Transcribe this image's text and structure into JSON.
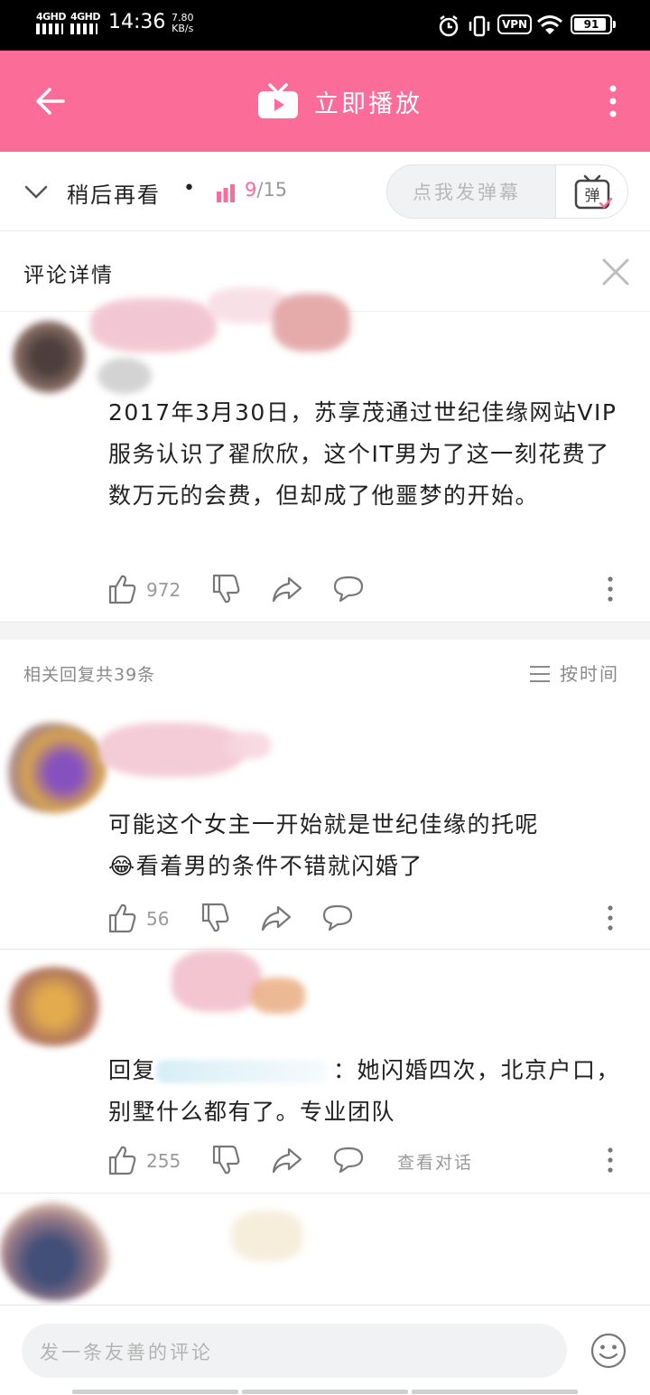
{
  "status_bar": {
    "network1": "4GHD",
    "network2": "4GHD",
    "time": "14:36",
    "speed_value": "7.80",
    "speed_unit": "KB/s",
    "vpn": "VPN",
    "battery": "91",
    "battery_level": 0.91
  },
  "header": {
    "title": "立即播放",
    "back_icon": "arrow-left-icon",
    "more_icon": "more-vertical-icon"
  },
  "watch_later": {
    "label": "稍后再看",
    "dot": "•",
    "current": "9",
    "total": "/15",
    "danmu_placeholder": "点我发弹幕",
    "danmu_icon_char": "弹"
  },
  "detail": {
    "title": "评论详情"
  },
  "main_comment": {
    "text": "2017年3月30日，苏享茂通过世纪佳缘网站VIP服务认识了翟欣欣，这个IT男为了这一刻花费了数万元的会费，但却成了他噩梦的开始。",
    "likes": "972"
  },
  "replies_header": {
    "count_label": "相关回复共39条",
    "sort_label": "按时间"
  },
  "replies": [
    {
      "text_line1": "可能这个女主一开始就是世纪佳缘的托呢",
      "text_line2": "😂看着男的条件不错就闪婚了",
      "likes": "56"
    },
    {
      "reply_prefix": "回复",
      "reply_suffix": "：她闪婚四次，北京户口，别墅什么都有了。专业团队",
      "likes": "255",
      "view_conversation": "查看对话"
    }
  ],
  "bottom_bar": {
    "placeholder": "发一条友善的评论"
  },
  "colors": {
    "accent": "#fb6c99",
    "text": "#212121",
    "muted": "#9a9a9a"
  }
}
